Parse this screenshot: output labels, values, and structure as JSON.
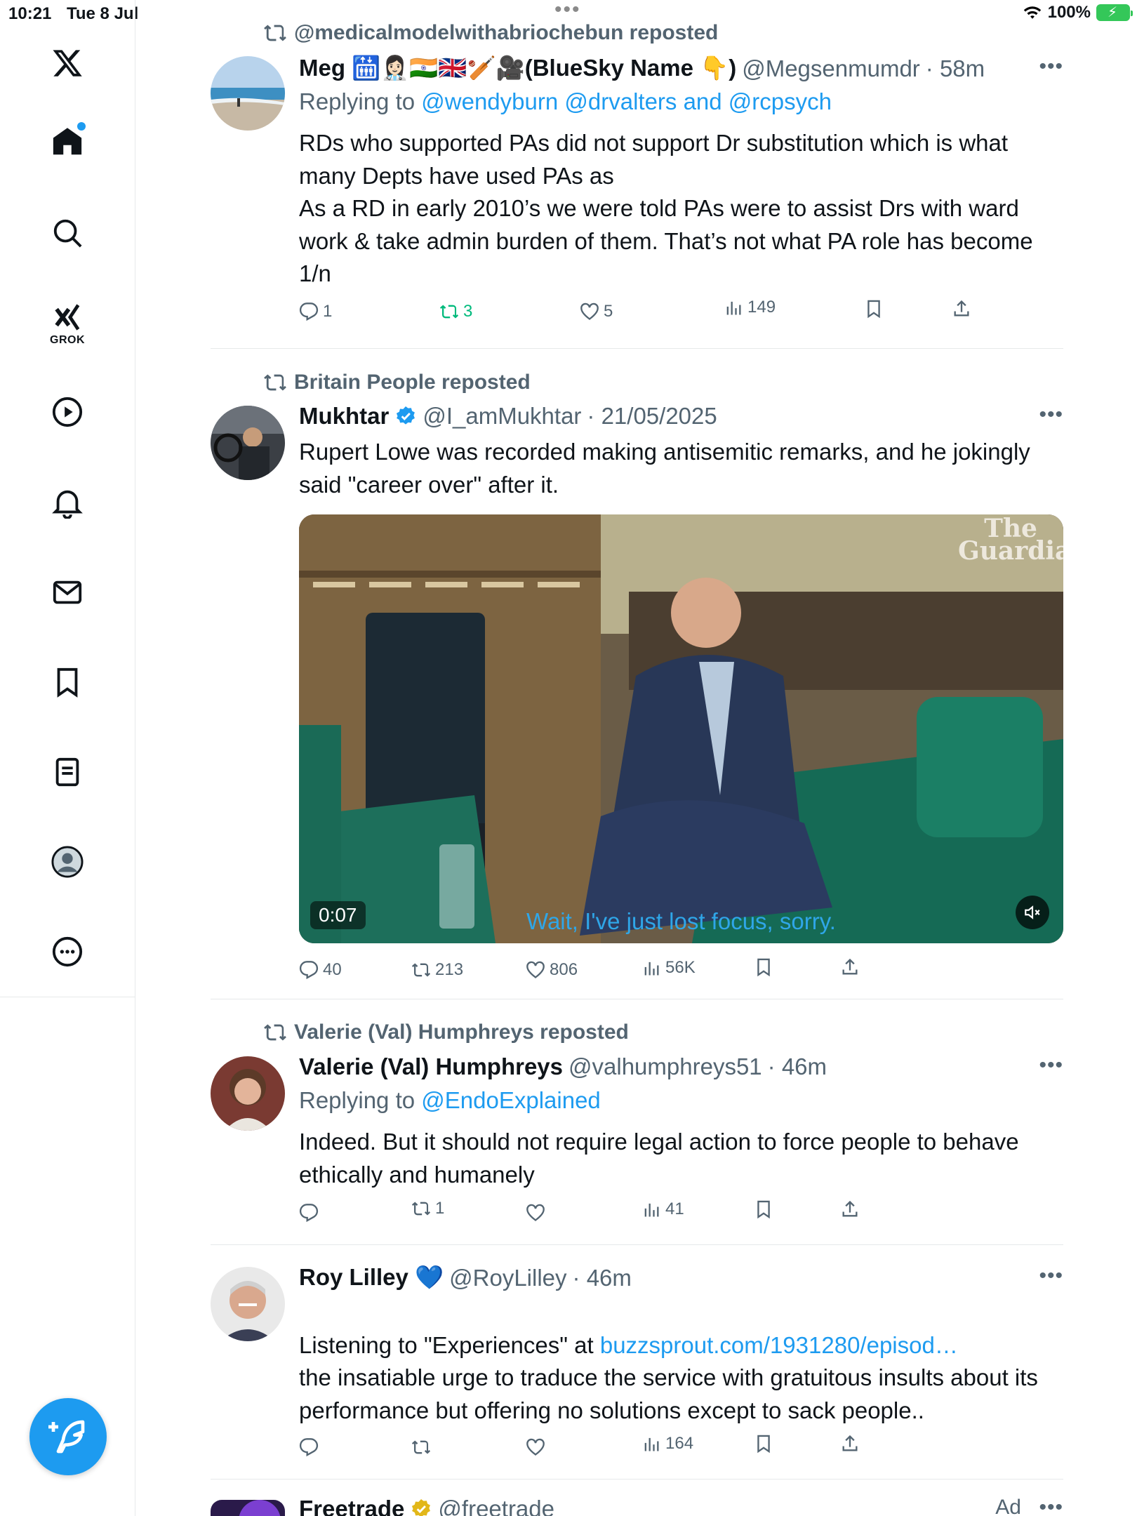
{
  "status": {
    "time": "10:21",
    "date": "Tue 8 Jul",
    "battery": "100%"
  },
  "sidebar": {
    "grok_label": "GROK"
  },
  "tweets": [
    {
      "repost_by": "@medicalmodelwithabriochebun reposted",
      "name": "Meg 🛗👩🏻‍⚕️🇮🇳🇬🇧🏏🎥(BlueSky Name 👇)",
      "handle": "@Megsenmumdr",
      "time": "· 58m",
      "replying_prefix": "Replying to ",
      "replying_to": "@wendyburn @drvalters and @rcpsych",
      "text": "RDs who supported PAs did not support Dr substitution which is what many Depts have used PAs as\nAs a RD in early 2010’s we were told PAs were to assist Drs with ward work & take admin burden of them. That’s not what PA role has become 1/n",
      "replies": "1",
      "reposts": "3",
      "likes": "5",
      "views": "149"
    },
    {
      "repost_by": "Britain People reposted",
      "name": "Mukhtar",
      "handle": "@I_amMukhtar",
      "time": "· 21/05/2025",
      "text": "Rupert Lowe was recorded making antisemitic remarks, and he jokingly said \"career over\" after it.",
      "video_time": "0:07",
      "video_subtitle": "Wait, I've just lost focus, sorry.",
      "video_logo": "The Guardian",
      "replies": "40",
      "reposts": "213",
      "likes": "806",
      "views": "56K"
    },
    {
      "repost_by": "Valerie (Val) Humphreys reposted",
      "name": "Valerie (Val) Humphreys",
      "handle": "@valhumphreys51",
      "time": "· 46m",
      "replying_prefix": "Replying to ",
      "replying_to": "@EndoExplained",
      "text": "Indeed. But it should not require legal action to force people to behave ethically and humanely",
      "replies": "",
      "reposts": "1",
      "likes": "",
      "views": "41"
    },
    {
      "name": "Roy Lilley 💙",
      "handle": "@RoyLilley",
      "time": "· 46m",
      "text_prefix": "Listening to \"Experiences\" at ",
      "link": "buzzsprout.com/1931280/episod…",
      "text": "the insatiable urge to traduce the service with gratuitous insults about its performance but offering no solutions except to sack people..",
      "replies": "",
      "reposts": "",
      "likes": "",
      "views": "164"
    },
    {
      "name": "Freetrade",
      "handle": "@freetrade",
      "ad_label": "Ad"
    }
  ],
  "colors": {
    "accent": "#1d9bf0",
    "muted": "#536471",
    "repost_active": "#00ba7c"
  }
}
